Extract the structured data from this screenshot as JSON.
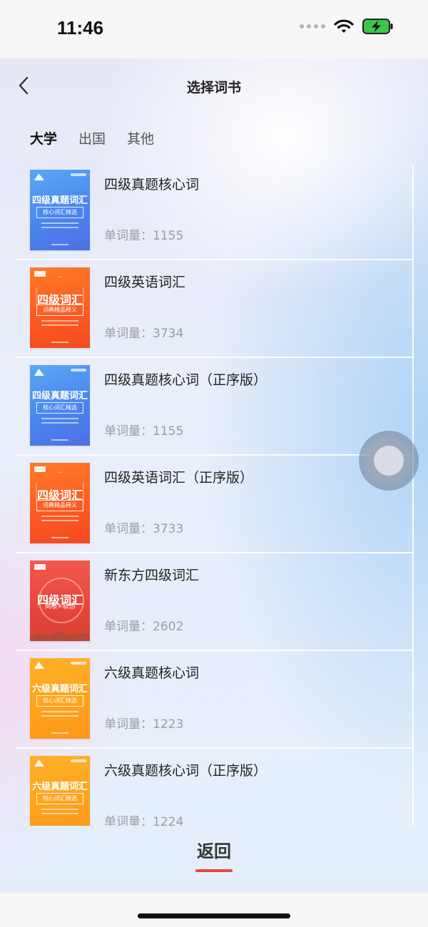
{
  "status_bar": {
    "time": "11:46"
  },
  "header": {
    "title": "选择词书"
  },
  "tabs": [
    {
      "label": "大学",
      "active": true
    },
    {
      "label": "出国",
      "active": false
    },
    {
      "label": "其他",
      "active": false
    }
  ],
  "books": [
    {
      "name": "四级真题核心词",
      "count": "单词量：1155",
      "cover": {
        "color": "blue",
        "title": "四级真题词汇",
        "subtitle": "核心词汇精选"
      }
    },
    {
      "name": "四级英语词汇",
      "count": "单词量：3734",
      "cover": {
        "color": "orange",
        "title": "四级词汇",
        "subtitle": "词典精品释义"
      }
    },
    {
      "name": "四级真题核心词（正序版）",
      "count": "单词量：1155",
      "cover": {
        "color": "blue",
        "title": "四级真题词汇",
        "subtitle": "核心词汇精选"
      }
    },
    {
      "name": "四级英语词汇（正序版）",
      "count": "单词量：3733",
      "cover": {
        "color": "orange",
        "title": "四级词汇",
        "subtitle": "词典精品释义"
      }
    },
    {
      "name": "新东方四级词汇",
      "count": "单词量：2602",
      "cover": {
        "color": "red",
        "title": "四级词汇",
        "subtitle": "词根+联想"
      }
    },
    {
      "name": "六级真题核心词",
      "count": "单词量：1223",
      "cover": {
        "color": "yellow",
        "title": "六级真题词汇",
        "subtitle": "核心词汇精选"
      }
    },
    {
      "name": "六级真题核心词（正序版）",
      "count": "单词量：1224",
      "cover": {
        "color": "yellow",
        "title": "六级真题词汇",
        "subtitle": "核心词汇精选"
      }
    }
  ],
  "footer": {
    "return_label": "返回"
  },
  "colors": {
    "accent": "#e8453c",
    "status_battery": "#3ac74a"
  }
}
